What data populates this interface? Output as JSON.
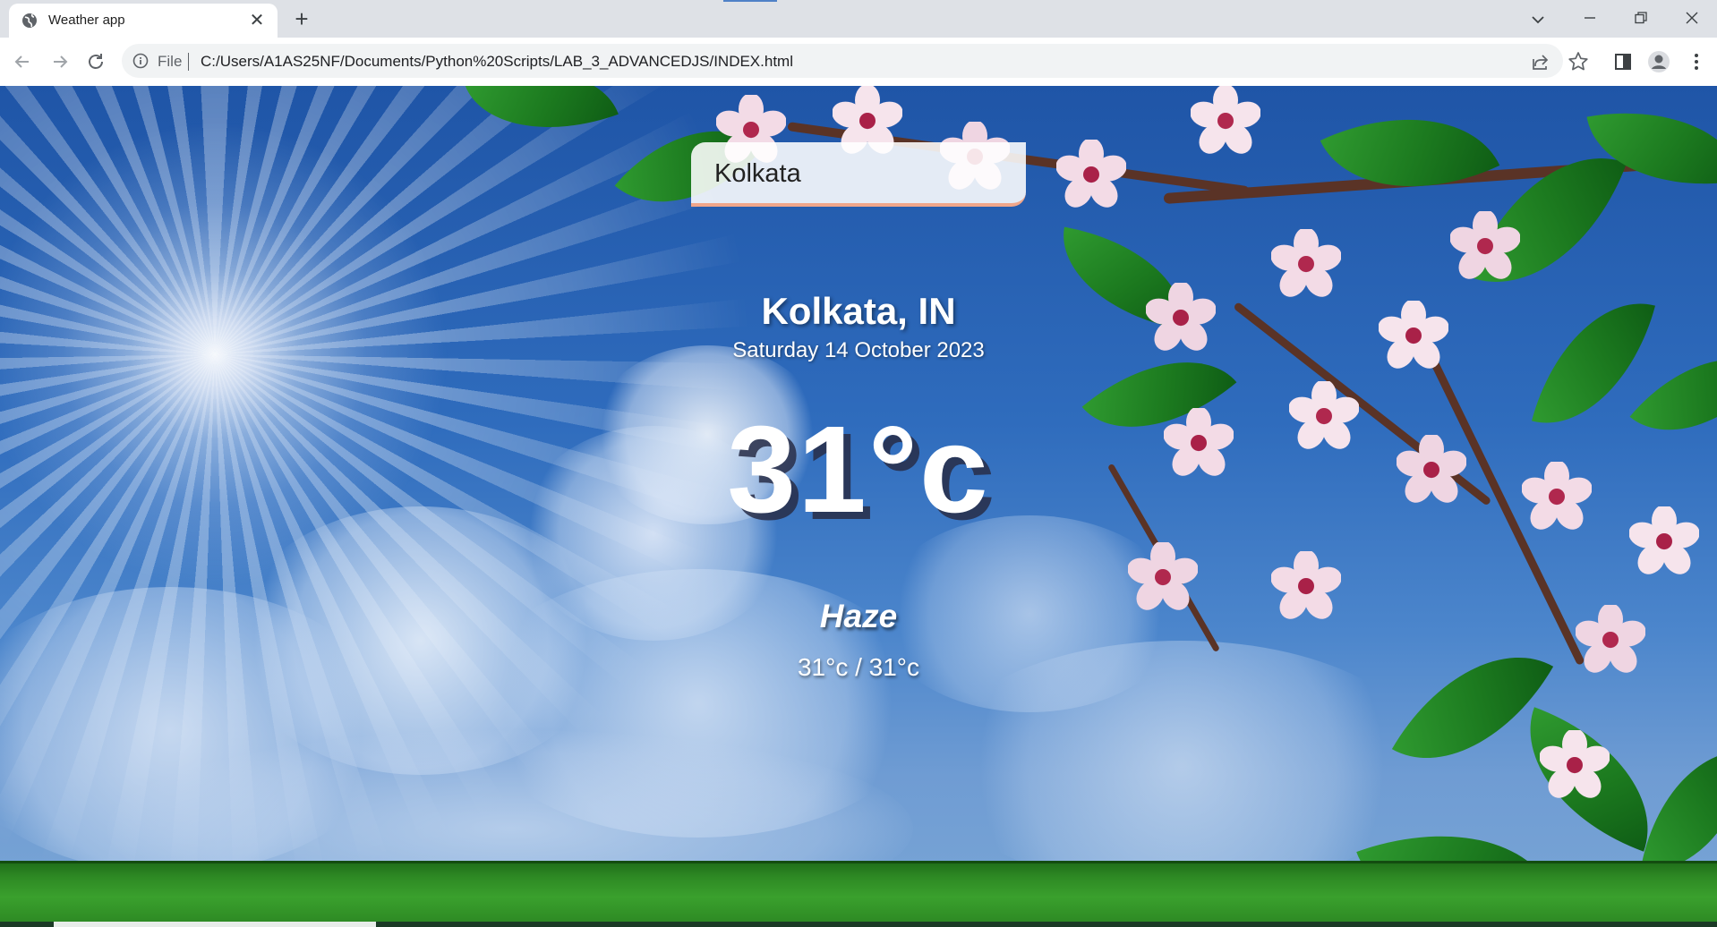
{
  "browser": {
    "tab_title": "Weather app",
    "new_tab_symbol": "+",
    "close_symbol": "✕",
    "file_label": "File",
    "url": "C:/Users/A1AS25NF/Documents/Python%20Scripts/LAB_3_ADVANCEDJS/INDEX.html"
  },
  "weather": {
    "search_value": "Kolkata",
    "city": "Kolkata, IN",
    "date": "Saturday 14 October 2023",
    "temperature": "31°c",
    "condition": "Haze",
    "hi_low": "31°c / 31°c"
  },
  "icons": {
    "favicon": "globe-icon",
    "back": "arrow-left-icon",
    "forward": "arrow-right-icon",
    "reload": "reload-icon",
    "info": "info-icon",
    "share": "share-icon",
    "bookmark": "star-icon",
    "sidepanel": "side-panel-icon",
    "profile": "profile-icon",
    "menu": "kebab-menu-icon"
  },
  "colors": {
    "chrome_bg": "#dee1e6",
    "search_accent": "#f0a68a",
    "temp_shadow": "#282d46"
  }
}
